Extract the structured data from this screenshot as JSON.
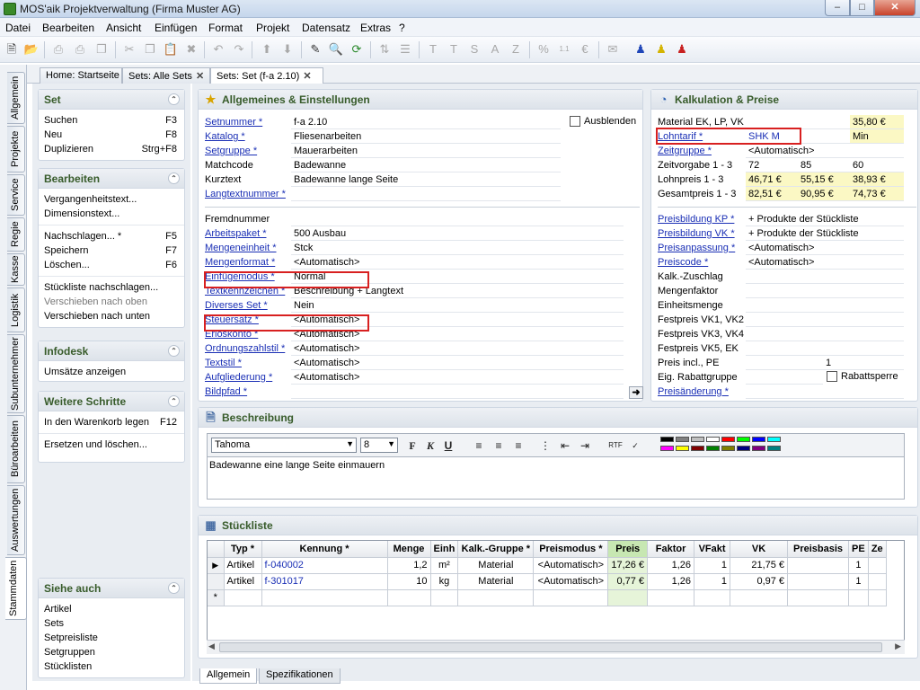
{
  "window": {
    "title": "MOS'aik Projektverwaltung (Firma Muster AG)",
    "min": "–",
    "max": "□",
    "close": "✕"
  },
  "menu": [
    "Datei",
    "Bearbeiten",
    "Ansicht",
    "Einfügen",
    "Format",
    "Projekt",
    "Datensatz",
    "Extras",
    "?"
  ],
  "side_tabs": [
    "Allgemein",
    "Projekte",
    "Service",
    "Regie",
    "Kasse",
    "Logistik",
    "Subunternehmer",
    "Büroarbeiten",
    "Auswertungen",
    "Stammdaten"
  ],
  "doc_tabs": [
    {
      "label": "Home: Startseite",
      "close": ""
    },
    {
      "label": "Sets: Alle Sets",
      "close": "✕"
    },
    {
      "label": "Sets: Set (f-a 2.10)",
      "close": "✕"
    }
  ],
  "left": {
    "set": {
      "title": "Set",
      "items": [
        {
          "label": "Suchen",
          "key": "F3"
        },
        {
          "label": "Neu",
          "key": "F8"
        },
        {
          "label": "Duplizieren",
          "key": "Strg+F8"
        }
      ]
    },
    "bearbeiten": {
      "title": "Bearbeiten",
      "group1": [
        "Vergangenheitstext...",
        "Dimensionstext..."
      ],
      "group2": [
        {
          "label": "Nachschlagen... *",
          "key": "F5"
        },
        {
          "label": "Speichern",
          "key": "F7"
        },
        {
          "label": "Löschen...",
          "key": "F6"
        }
      ],
      "group3": [
        "Stückliste nachschlagen...",
        "Verschieben nach oben",
        "Verschieben nach unten"
      ]
    },
    "infodesk": {
      "title": "Infodesk",
      "items": [
        "Umsätze anzeigen"
      ]
    },
    "weitere": {
      "title": "Weitere Schritte",
      "item1": {
        "label": "In den Warenkorb legen",
        "key": "F12"
      },
      "item2": "Ersetzen und löschen..."
    },
    "siehe": {
      "title": "Siehe auch",
      "items": [
        "Artikel",
        "Sets",
        "Setpreisliste",
        "Setgruppen",
        "Stücklisten"
      ]
    }
  },
  "allgemeines": {
    "title": "Allgemeines & Einstellungen",
    "ausblenden": "Ausblenden",
    "top": [
      {
        "label": "Setnummer *",
        "value": "f-a 2.10",
        "link": true
      },
      {
        "label": "Katalog *",
        "value": "Fliesenarbeiten",
        "link": true
      },
      {
        "label": "Setgruppe *",
        "value": "Mauerarbeiten",
        "link": true
      },
      {
        "label": "Matchcode",
        "value": "Badewanne",
        "link": false
      },
      {
        "label": "Kurztext",
        "value": "Badewanne lange Seite",
        "link": false
      },
      {
        "label": "Langtextnummer *",
        "value": "",
        "link": true
      }
    ],
    "bottom": [
      {
        "label": "Fremdnummer",
        "value": "",
        "link": false
      },
      {
        "label": "Arbeitspaket *",
        "value": "500 Ausbau",
        "link": true
      },
      {
        "label": "Mengeneinheit *",
        "value": "Stck",
        "link": true
      },
      {
        "label": "Mengenformat *",
        "value": "<Automatisch>",
        "link": true
      },
      {
        "label": "Einfügemodus *",
        "value": "Normal",
        "link": true
      },
      {
        "label": "Textkennzeichen *",
        "value": "Beschreibung + Langtext",
        "link": true
      },
      {
        "label": "Diverses Set *",
        "value": "Nein",
        "link": true
      },
      {
        "label": "Steuersatz *",
        "value": "<Automatisch>",
        "link": true
      },
      {
        "label": "Erlöskonto *",
        "value": "<Automatisch>",
        "link": true
      },
      {
        "label": "Ordnungszahlstil *",
        "value": "<Automatisch>",
        "link": true
      },
      {
        "label": "Textstil *",
        "value": "<Automatisch>",
        "link": true
      },
      {
        "label": "Aufgliederung *",
        "value": "<Automatisch>",
        "link": true
      },
      {
        "label": "Bildpfad *",
        "value": "",
        "link": true
      }
    ]
  },
  "kalkulation": {
    "title": "Kalkulation & Preise",
    "material": {
      "label": "Material EK, LP, VK",
      "v1": "",
      "v2": "",
      "v3": "35,80 €"
    },
    "lohntarif": {
      "label": "Lohntarif *",
      "v1": "SHK M",
      "v2": "",
      "v3": "Min"
    },
    "zeitgruppe": {
      "label": "Zeitgruppe *",
      "v1": "<Automatisch>"
    },
    "zeitvorgabe": {
      "label": "Zeitvorgabe 1 - 3",
      "v1": "72",
      "v2": "85",
      "v3": "60"
    },
    "lohnpreis": {
      "label": "Lohnpreis 1 - 3",
      "v1": "46,71 €",
      "v2": "55,15 €",
      "v3": "38,93 €"
    },
    "gesamtpreis": {
      "label": "Gesamtpreis 1 - 3",
      "v1": "82,51 €",
      "v2": "90,95 €",
      "v3": "74,73 €"
    },
    "rows2": [
      {
        "label": "Preisbildung KP *",
        "value": "+ Produkte der Stückliste",
        "link": true
      },
      {
        "label": "Preisbildung VK *",
        "value": "+ Produkte der Stückliste",
        "link": true
      },
      {
        "label": "Preisanpassung *",
        "value": "<Automatisch>",
        "link": true
      },
      {
        "label": "Preiscode *",
        "value": "<Automatisch>",
        "link": true
      },
      {
        "label": "Kalk.-Zuschlag",
        "value": "",
        "link": false
      },
      {
        "label": "Mengenfaktor",
        "value": "",
        "link": false
      },
      {
        "label": "Einheitsmenge",
        "value": "",
        "link": false
      }
    ],
    "festpreise": [
      {
        "label": "Festpreis VK1, VK2"
      },
      {
        "label": "Festpreis VK3, VK4"
      },
      {
        "label": "Festpreis VK5, EK"
      }
    ],
    "preisincl": {
      "label": "Preis incl., PE",
      "v2": "1"
    },
    "rabatt": {
      "label": "Eig. Rabattgruppe",
      "check": "Rabattsperre"
    },
    "preisaenderung": {
      "label": "Preisänderung *"
    }
  },
  "beschreibung": {
    "title": "Beschreibung",
    "font": "Tahoma",
    "size": "8",
    "text": "Badewanne eine lange Seite einmauern",
    "palette": [
      "#000000",
      "#808080",
      "#c0c0c0",
      "#ffffff",
      "#ff0000",
      "#00ff00",
      "#0000ff",
      "#00ffff",
      "#ff00ff",
      "#ffff00",
      "#800000",
      "#008000",
      "#808000",
      "#000080",
      "#800080",
      "#008080"
    ]
  },
  "stueckliste": {
    "title": "Stückliste",
    "columns": [
      "",
      "Typ *",
      "Kennung *",
      "Menge",
      "Einh",
      "Kalk.-Gruppe *",
      "Preismodus *",
      "Preis",
      "Faktor",
      "VFakt",
      "VK",
      "Preisbasis",
      "PE",
      "Ze"
    ],
    "rows": [
      {
        "marker": "▶",
        "typ": "Artikel",
        "kennung": "f-040002",
        "menge": "1,2",
        "einh": "m²",
        "gruppe": "Material",
        "modus": "<Automatisch>",
        "preis": "17,26 €",
        "faktor": "1,26",
        "vfakt": "1",
        "vk": "21,75 €",
        "basis": "",
        "pe": "1",
        "ze": ""
      },
      {
        "marker": "",
        "typ": "Artikel",
        "kennung": "f-301017",
        "menge": "10",
        "einh": "kg",
        "gruppe": "Material",
        "modus": "<Automatisch>",
        "preis": "0,77 €",
        "faktor": "1,26",
        "vfakt": "1",
        "vk": "0,97 €",
        "basis": "",
        "pe": "1",
        "ze": ""
      }
    ],
    "newrow": "*"
  },
  "bottom_tabs": [
    "Allgemein",
    "Spezifikationen"
  ]
}
